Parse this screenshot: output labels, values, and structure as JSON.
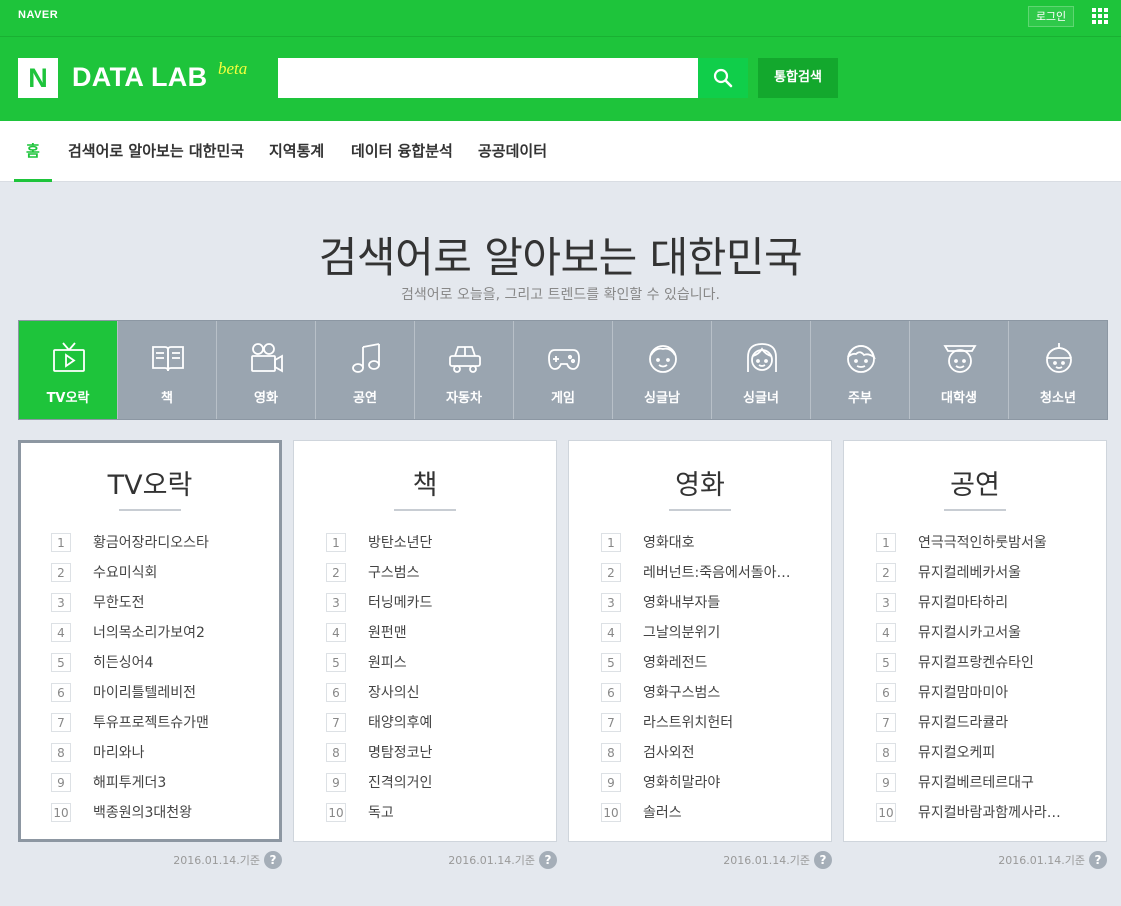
{
  "topbar": {
    "logo": "NAVER",
    "login": "로그인"
  },
  "header": {
    "brand": "DATA LAB",
    "beta": "beta",
    "search_placeholder": "",
    "total_search": "통합검색"
  },
  "nav": {
    "items": [
      {
        "label": "홈"
      },
      {
        "label": "검색어로 알아보는 대한민국"
      },
      {
        "label": "지역통계"
      },
      {
        "label": "데이터 융합분석"
      },
      {
        "label": "공공데이터"
      }
    ]
  },
  "main": {
    "title": "검색어로 알아보는 대한민국",
    "subtitle": "검색어로 오늘을, 그리고 트렌드를 확인할 수 있습니다.",
    "categories": [
      {
        "label": "TV오락",
        "icon": "tv-icon"
      },
      {
        "label": "책",
        "icon": "book-icon"
      },
      {
        "label": "영화",
        "icon": "movie-camera-icon"
      },
      {
        "label": "공연",
        "icon": "music-note-icon"
      },
      {
        "label": "자동차",
        "icon": "car-icon"
      },
      {
        "label": "게임",
        "icon": "gamepad-icon"
      },
      {
        "label": "싱글남",
        "icon": "single-man-icon"
      },
      {
        "label": "싱글녀",
        "icon": "single-woman-icon"
      },
      {
        "label": "주부",
        "icon": "housewife-icon"
      },
      {
        "label": "대학생",
        "icon": "college-student-icon"
      },
      {
        "label": "청소년",
        "icon": "teenager-icon"
      }
    ],
    "panels": [
      {
        "title": "TV오락",
        "date": "2016.01.14.기준",
        "items": [
          "황금어장라디오스타",
          "수요미식회",
          "무한도전",
          "너의목소리가보여2",
          "히든싱어4",
          "마이리틀텔레비전",
          "투유프로젝트슈가맨",
          "마리와나",
          "해피투게더3",
          "백종원의3대천왕"
        ]
      },
      {
        "title": "책",
        "date": "2016.01.14.기준",
        "items": [
          "방탄소년단",
          "구스범스",
          "터닝메카드",
          "원펀맨",
          "원피스",
          "장사의신",
          "태양의후예",
          "명탐정코난",
          "진격의거인",
          "독고"
        ]
      },
      {
        "title": "영화",
        "date": "2016.01.14.기준",
        "items": [
          "영화대호",
          "레버넌트:죽음에서돌아…",
          "영화내부자들",
          "그날의분위기",
          "영화레전드",
          "영화구스범스",
          "라스트위치헌터",
          "검사외전",
          "영화히말라야",
          "솔러스"
        ]
      },
      {
        "title": "공연",
        "date": "2016.01.14.기준",
        "items": [
          "연극극적인하룻밤서울",
          "뮤지컬레베카서울",
          "뮤지컬마타하리",
          "뮤지컬시카고서울",
          "뮤지컬프랑켄슈타인",
          "뮤지컬맘마미아",
          "뮤지컬드라큘라",
          "뮤지컬오케피",
          "뮤지컬베르테르대구",
          "뮤지컬바람과함께사라…"
        ]
      }
    ]
  },
  "colors": {
    "brand_green": "#1ec43b",
    "category_bg": "#9aa5b0",
    "page_bg": "#e4e8ee"
  }
}
